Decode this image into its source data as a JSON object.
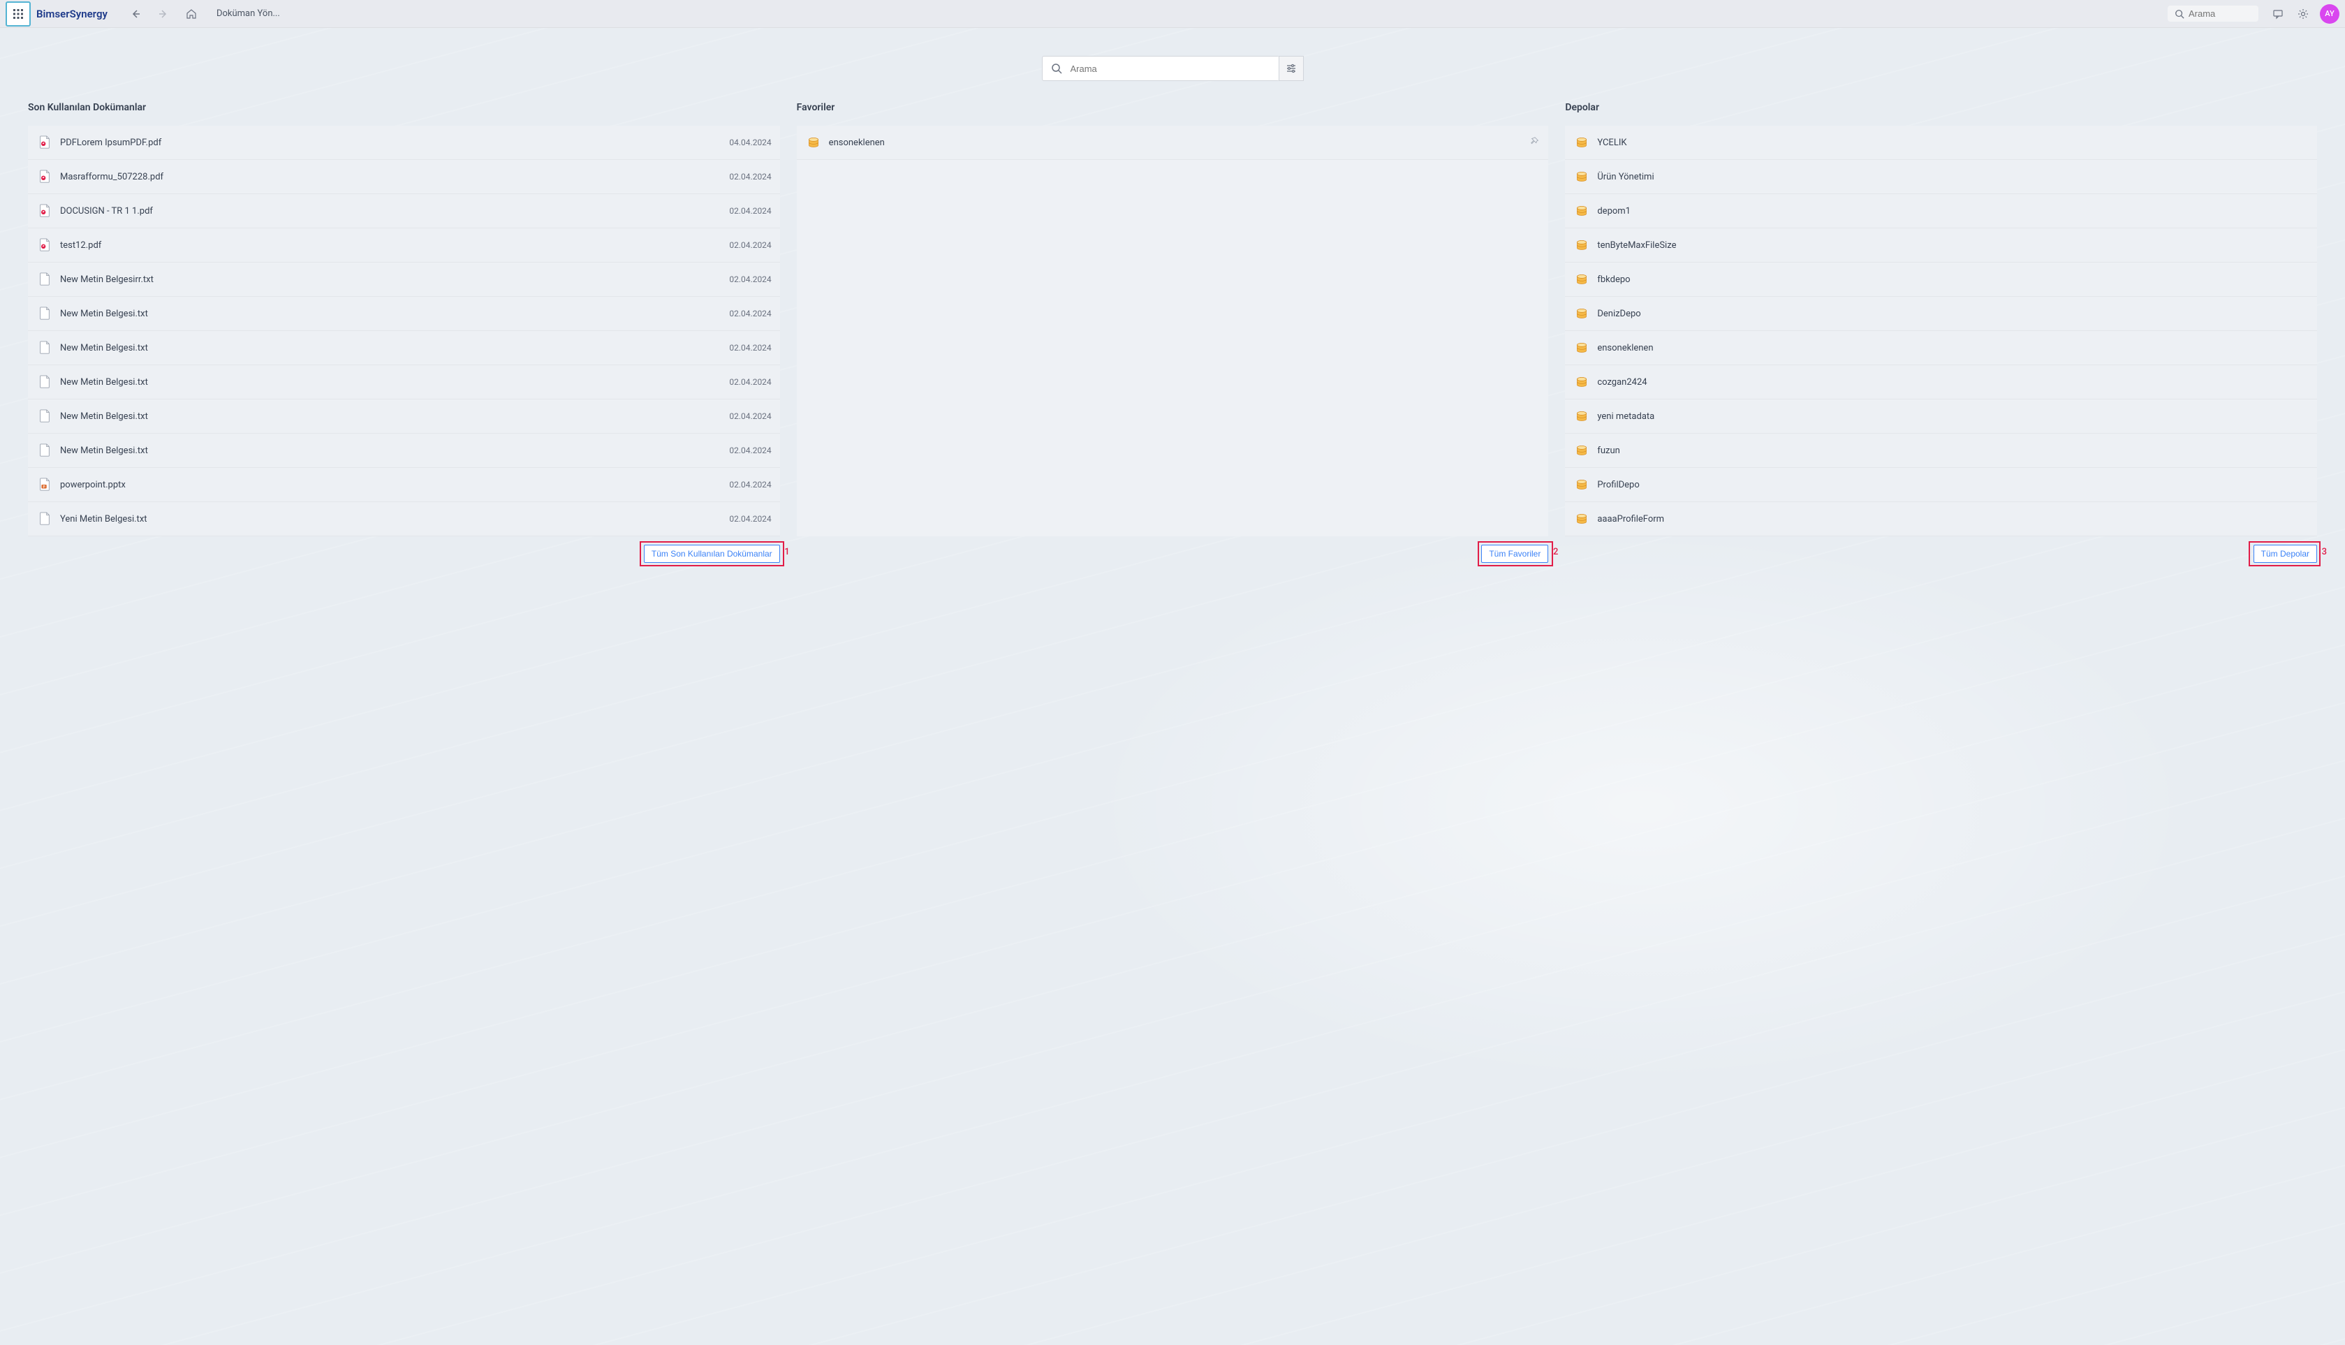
{
  "header": {
    "logo": "BimserSynergy",
    "breadcrumb": "Doküman Yön...",
    "search_placeholder": "Arama",
    "avatar_initials": "AY"
  },
  "main_search": {
    "placeholder": "Arama"
  },
  "columns": {
    "recent": {
      "title": "Son Kullanılan Dokümanlar",
      "footer_btn": "Tüm Son Kullanılan Dokümanlar",
      "items": [
        {
          "icon": "pdf",
          "name": "PDFLorem IpsumPDF.pdf",
          "date": "04.04.2024"
        },
        {
          "icon": "pdf",
          "name": "Masrafformu_507228.pdf",
          "date": "02.04.2024"
        },
        {
          "icon": "pdf",
          "name": "DOCUSIGN - TR 1 1.pdf",
          "date": "02.04.2024"
        },
        {
          "icon": "pdf",
          "name": "test12.pdf",
          "date": "02.04.2024"
        },
        {
          "icon": "txt",
          "name": "New Metin Belgesirr.txt",
          "date": "02.04.2024"
        },
        {
          "icon": "txt",
          "name": "New Metin Belgesi.txt",
          "date": "02.04.2024"
        },
        {
          "icon": "txt",
          "name": "New Metin Belgesi.txt",
          "date": "02.04.2024"
        },
        {
          "icon": "txt",
          "name": "New Metin Belgesi.txt",
          "date": "02.04.2024"
        },
        {
          "icon": "txt",
          "name": "New Metin Belgesi.txt",
          "date": "02.04.2024"
        },
        {
          "icon": "txt",
          "name": "New Metin Belgesi.txt",
          "date": "02.04.2024"
        },
        {
          "icon": "pptx",
          "name": "powerpoint.pptx",
          "date": "02.04.2024"
        },
        {
          "icon": "txt",
          "name": "Yeni Metin Belgesi.txt",
          "date": "02.04.2024"
        }
      ]
    },
    "favorites": {
      "title": "Favoriler",
      "footer_btn": "Tüm Favoriler",
      "items": [
        {
          "icon": "db",
          "name": "ensoneklenen",
          "pin": true
        }
      ]
    },
    "repos": {
      "title": "Depolar",
      "footer_btn": "Tüm Depolar",
      "items": [
        {
          "icon": "db",
          "name": "YCELIK"
        },
        {
          "icon": "db",
          "name": "Ürün Yönetimi"
        },
        {
          "icon": "db",
          "name": "depom1"
        },
        {
          "icon": "db",
          "name": "tenByteMaxFileSize"
        },
        {
          "icon": "db",
          "name": "fbkdepo"
        },
        {
          "icon": "db",
          "name": "DenizDepo"
        },
        {
          "icon": "db",
          "name": "ensoneklenen"
        },
        {
          "icon": "db",
          "name": "cozgan2424"
        },
        {
          "icon": "db",
          "name": "yeni metadata"
        },
        {
          "icon": "db",
          "name": "fuzun"
        },
        {
          "icon": "db",
          "name": "ProfilDepo"
        },
        {
          "icon": "db",
          "name": "aaaaProfileForm"
        }
      ]
    }
  },
  "annotations": {
    "a1": "1",
    "a2": "2",
    "a3": "3"
  }
}
